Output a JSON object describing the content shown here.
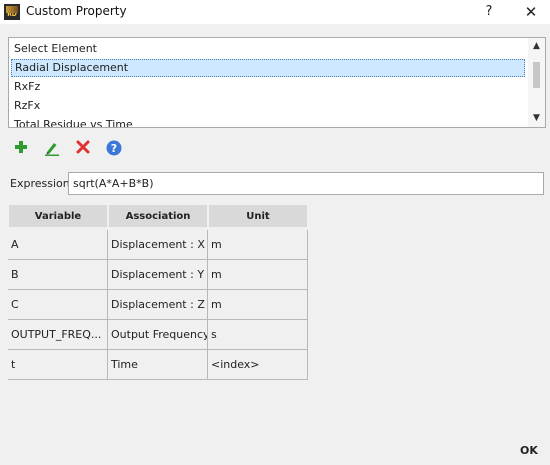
{
  "window": {
    "title": "Custom Property",
    "help_label": "?",
    "close_label": "✕"
  },
  "element_list": {
    "items": [
      "Select Element",
      "Radial Displacement",
      "RxFz",
      "RzFx",
      "Total Residue vs Time"
    ],
    "selected_index": 1
  },
  "toolbar": {
    "add_icon": "plus-icon",
    "edit_icon": "pencil-icon",
    "delete_icon": "delete-x-icon",
    "help_icon": "help-icon",
    "colors": {
      "add": "#2e9b2e",
      "edit": "#2e9b2e",
      "delete": "#e03030",
      "help": "#3a78d8"
    }
  },
  "expression": {
    "label": "Expression",
    "value": "sqrt(A*A+B*B)"
  },
  "table": {
    "headers": [
      "Variable",
      "Association",
      "Unit"
    ],
    "rows": [
      [
        "A",
        "Displacement : X",
        "m"
      ],
      [
        "B",
        "Displacement : Y",
        "m"
      ],
      [
        "C",
        "Displacement : Z",
        "m"
      ],
      [
        "OUTPUT_FREQ...",
        "Output Frequency",
        "s"
      ],
      [
        "t",
        "Time",
        "<index>"
      ]
    ]
  },
  "footer": {
    "ok_label": "OK"
  }
}
